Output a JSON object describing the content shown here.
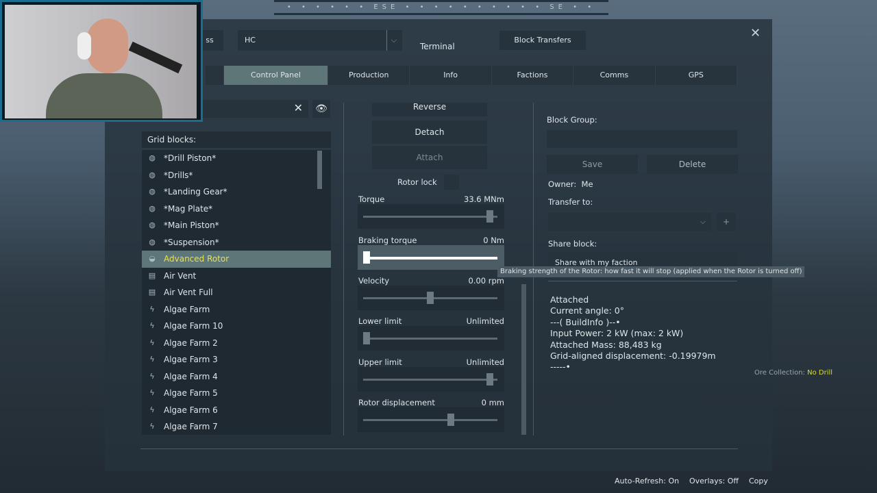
{
  "compass": {
    "label1": "ESE",
    "label2": "SE"
  },
  "header": {
    "partial_button": "ss",
    "grid_select": "HC",
    "title": "Terminal",
    "block_transfers": "Block Transfers",
    "close": "✕"
  },
  "tabs": [
    "Control Panel",
    "Production",
    "Info",
    "Factions",
    "Comms",
    "GPS"
  ],
  "search": {
    "clear": "✕"
  },
  "grid_blocks": {
    "title": "Grid blocks:",
    "items": [
      {
        "label": "*Drill Piston*",
        "icon": "group-icon"
      },
      {
        "label": "*Drills*",
        "icon": "group-icon"
      },
      {
        "label": "*Landing Gear*",
        "icon": "group-icon"
      },
      {
        "label": "*Mag Plate*",
        "icon": "group-icon"
      },
      {
        "label": "*Main Piston*",
        "icon": "group-icon"
      },
      {
        "label": "*Suspension*",
        "icon": "group-icon"
      },
      {
        "label": "Advanced Rotor",
        "icon": "rotor-icon",
        "selected": true
      },
      {
        "label": "Air Vent",
        "icon": "vent-icon"
      },
      {
        "label": "Air Vent Full",
        "icon": "vent-icon"
      },
      {
        "label": "Algae Farm",
        "icon": "farm-icon"
      },
      {
        "label": "Algae Farm 10",
        "icon": "farm-icon"
      },
      {
        "label": "Algae Farm 2",
        "icon": "farm-icon"
      },
      {
        "label": "Algae Farm 3",
        "icon": "farm-icon"
      },
      {
        "label": "Algae Farm 4",
        "icon": "farm-icon"
      },
      {
        "label": "Algae Farm 5",
        "icon": "farm-icon"
      },
      {
        "label": "Algae Farm 6",
        "icon": "farm-icon"
      },
      {
        "label": "Algae Farm 7",
        "icon": "farm-icon"
      }
    ]
  },
  "controls": {
    "reverse": "Reverse",
    "detach": "Detach",
    "attach": "Attach",
    "rotor_lock": "Rotor lock",
    "sliders": [
      {
        "label": "Torque",
        "value": "33.6 MNm",
        "fraction": 0.97
      },
      {
        "label": "Braking torque",
        "value": "0 Nm",
        "fraction": 0.0
      },
      {
        "label": "Velocity",
        "value": "0.00 rpm",
        "fraction": 0.5
      },
      {
        "label": "Lower limit",
        "value": "Unlimited",
        "fraction": 0.0
      },
      {
        "label": "Upper limit",
        "value": "Unlimited",
        "fraction": 0.97
      },
      {
        "label": "Rotor displacement",
        "value": "0 mm",
        "fraction": 0.66
      }
    ]
  },
  "tooltip": "Braking strength of the Rotor: how fast it will stop (applied when the Rotor is turned off)",
  "right": {
    "block_group": "Block Group:",
    "save": "Save",
    "delete": "Delete",
    "owner_label": "Owner:",
    "owner": "Me",
    "transfer_to": "Transfer to:",
    "add": "+",
    "share_block": "Share block:",
    "share_value": "Share with my faction"
  },
  "info_lines": [
    "Attached",
    "Current angle: 0°",
    "---( BuildInfo )--•",
    "Input Power: 2 kW (max: 2 kW)",
    "Attached Mass: 88,483 kg",
    "Grid-aligned displacement: -0.19979m",
    "-----•"
  ],
  "ore": {
    "label": "Ore Collection:",
    "value": "No Drill"
  },
  "footer": {
    "auto_refresh": "Auto-Refresh: On",
    "overlays": "Overlays: Off",
    "copy": "Copy"
  }
}
